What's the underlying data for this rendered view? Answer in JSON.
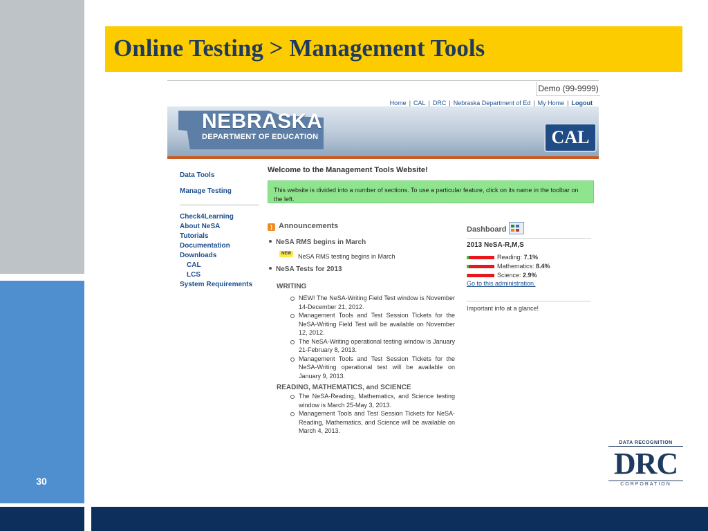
{
  "slide": {
    "title": "Online Testing > Management Tools",
    "number": "30"
  },
  "site": {
    "user_box": "Demo (99-9999)",
    "top_links": [
      {
        "label": "Home"
      },
      {
        "label": "CAL"
      },
      {
        "label": "DRC"
      },
      {
        "label": "Nebraska Department of Ed"
      },
      {
        "label": "My Home"
      },
      {
        "label": "Logout"
      }
    ],
    "banner": {
      "state_name": "NEBRASKA",
      "department": "DEPARTMENT OF EDUCATION",
      "partner_logo": "CAL"
    },
    "nav": {
      "data_tools": "Data Tools",
      "manage_testing": "Manage Testing",
      "check4learning": "Check4Learning",
      "about": "About NeSA",
      "tutorials": "Tutorials",
      "documentation": "Documentation",
      "downloads": "Downloads",
      "cal": "CAL",
      "lcs": "LCS",
      "system_requirements": "System Requirements"
    },
    "welcome": "Welcome to the Management Tools Website!",
    "info": "This website is divided into a number of sections. To use a particular feature, click on its name in the toolbar on the left.",
    "announcements": {
      "heading": "Announcements",
      "item1": "NeSA RMS begins in March",
      "new_badge": "NEW",
      "item1_detail": "NeSA RMS testing begins in March",
      "item2": "NeSA Tests for 2013",
      "writing_heading": "WRITING",
      "writing_items": [
        "NEW! The NeSA-Writing Field Test window is November 14-December 21, 2012.",
        "Management Tools and Test Session Tickets for the NeSA-Writing Field Test will be available on November 12, 2012.",
        "The NeSA-Writing operational testing window is January 21-February 8, 2013.",
        "Management Tools and Test Session Tickets for the NeSA-Writing operational test will be available on January 9, 2013."
      ],
      "rms_heading": "READING, MATHEMATICS, and SCIENCE",
      "rms_items": [
        "The NeSA-Reading, Mathematics, and Science testing window is March 25-May 3, 2013.",
        "Management Tools and Test Session Tickets for NeSA-Reading, Mathematics, and Science will be available on March 4, 2013."
      ]
    },
    "dashboard": {
      "heading": "Dashboard",
      "title": "2013 NeSA-R,M,S",
      "rows": [
        {
          "label": "Reading:",
          "value": "7.1%",
          "pct": 7.1
        },
        {
          "label": "Mathematics:",
          "value": "8.4%",
          "pct": 8.4
        },
        {
          "label": "Science:",
          "value": "2.9%",
          "pct": 2.9
        }
      ],
      "link": "Go to this administration.",
      "note": "Important info at a glance!",
      "colors": {
        "progress": "#3fc23f",
        "remaining": "#e8171b"
      }
    }
  },
  "drc_logo": {
    "top": "DATA RECOGNITION",
    "main": "DRC",
    "bottom": "CORPORATION"
  }
}
